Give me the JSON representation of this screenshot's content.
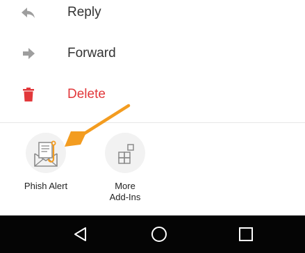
{
  "menu": {
    "items": [
      {
        "label": "Reply",
        "icon": "reply-icon"
      },
      {
        "label": "Forward",
        "icon": "forward-arrow-icon"
      },
      {
        "label": "Delete",
        "icon": "trash-icon",
        "color": "#e2383b"
      }
    ]
  },
  "addins": {
    "items": [
      {
        "label": "Phish Alert",
        "icon": "phish-alert-icon"
      },
      {
        "label_line1": "More",
        "label_line2": "Add-Ins",
        "icon": "add-ins-grid-icon"
      }
    ]
  },
  "callout": {
    "color": "#f39c20",
    "icon": "arrow-callout-icon"
  },
  "navbar": {
    "buttons": [
      {
        "name": "back",
        "icon": "back-triangle-icon"
      },
      {
        "name": "home",
        "icon": "home-circle-icon"
      },
      {
        "name": "recents",
        "icon": "recents-square-icon"
      }
    ]
  },
  "colors": {
    "icon_gray": "#9e9e9e",
    "danger": "#e2383b",
    "accent": "#f39c20",
    "navbar": "#050505"
  }
}
